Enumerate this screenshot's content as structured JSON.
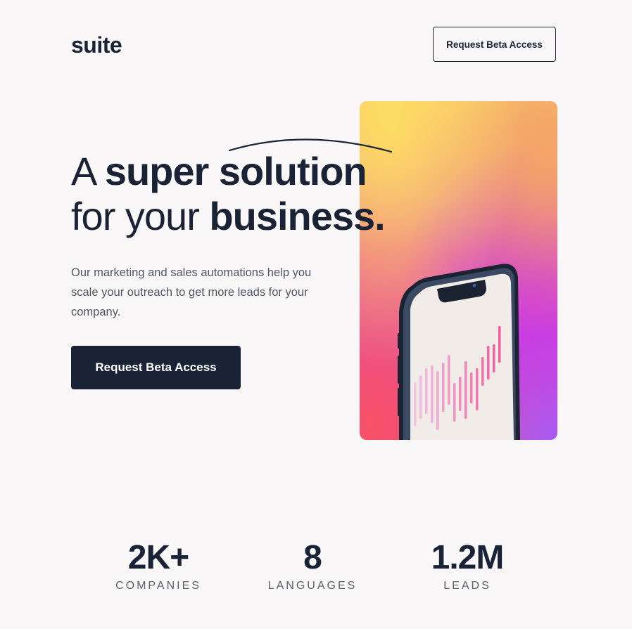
{
  "header": {
    "logo": "suite",
    "nav_button_label": "Request Beta Access"
  },
  "hero": {
    "headline_line1_regular": "A ",
    "headline_line1_bold_a": "super ",
    "headline_line1_bold_b": "solution",
    "headline_line2_regular": "for your ",
    "headline_line2_bold": "business.",
    "description": "Our marketing and sales automations help you scale your outreach to get more leads for your company.",
    "cta_label": "Request Beta Access"
  },
  "stats": [
    {
      "value": "2K+",
      "label": "COMPANIES"
    },
    {
      "value": "8",
      "label": "LANGUAGES"
    },
    {
      "value": "1.2M",
      "label": "LEADS"
    }
  ],
  "colors": {
    "navy": "#1a2336",
    "background": "#f9f7f7",
    "bar_light": "#f0c4e4",
    "bar_dark": "#ee5c9e"
  },
  "icons": {
    "phone_illustration": "smartphone-with-bar-chart-icon"
  }
}
